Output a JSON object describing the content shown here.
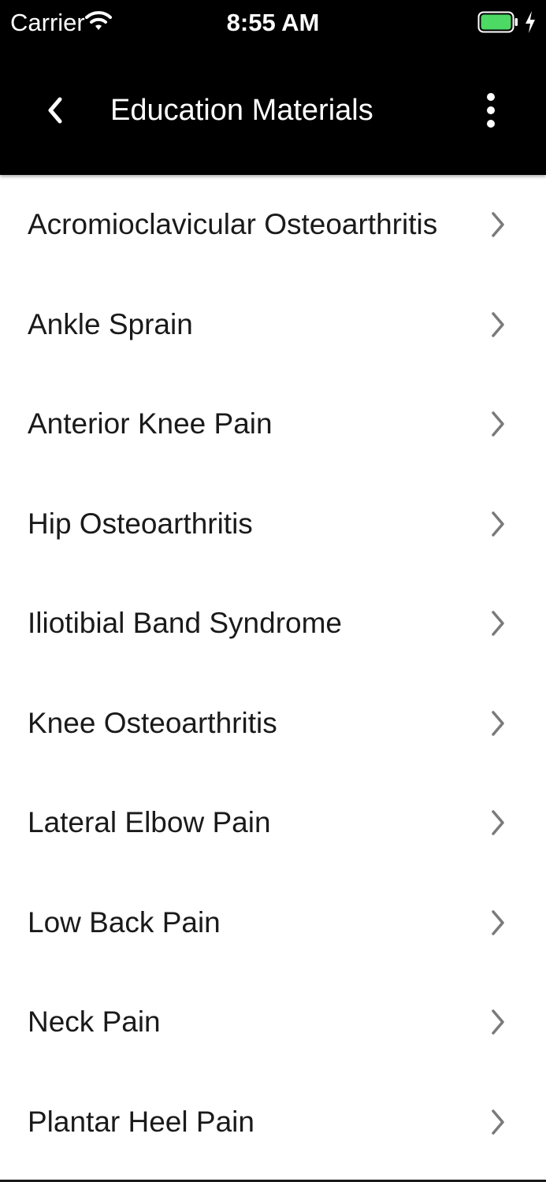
{
  "status_bar": {
    "carrier": "Carrier",
    "time": "8:55 AM",
    "battery_color": "#4cd964",
    "icons": [
      "wifi-icon",
      "battery-icon",
      "charging-bolt-icon"
    ]
  },
  "nav": {
    "title": "Education Materials",
    "back_icon": "chevron-left-icon",
    "menu_icon": "more-vertical-icon"
  },
  "list": {
    "chevron_icon": "chevron-right-icon",
    "items": [
      {
        "label": "Acromioclavicular Osteoarthritis"
      },
      {
        "label": "Ankle Sprain"
      },
      {
        "label": "Anterior Knee Pain"
      },
      {
        "label": "Hip Osteoarthritis"
      },
      {
        "label": "Iliotibial Band Syndrome"
      },
      {
        "label": "Knee Osteoarthritis"
      },
      {
        "label": "Lateral Elbow Pain"
      },
      {
        "label": "Low Back Pain"
      },
      {
        "label": "Neck Pain"
      },
      {
        "label": "Plantar Heel Pain"
      }
    ]
  },
  "colors": {
    "header_background": "#000000",
    "header_text": "#ffffff",
    "list_background": "#ffffff",
    "list_text": "#1a1a1a",
    "chevron": "#7a7a7a"
  }
}
